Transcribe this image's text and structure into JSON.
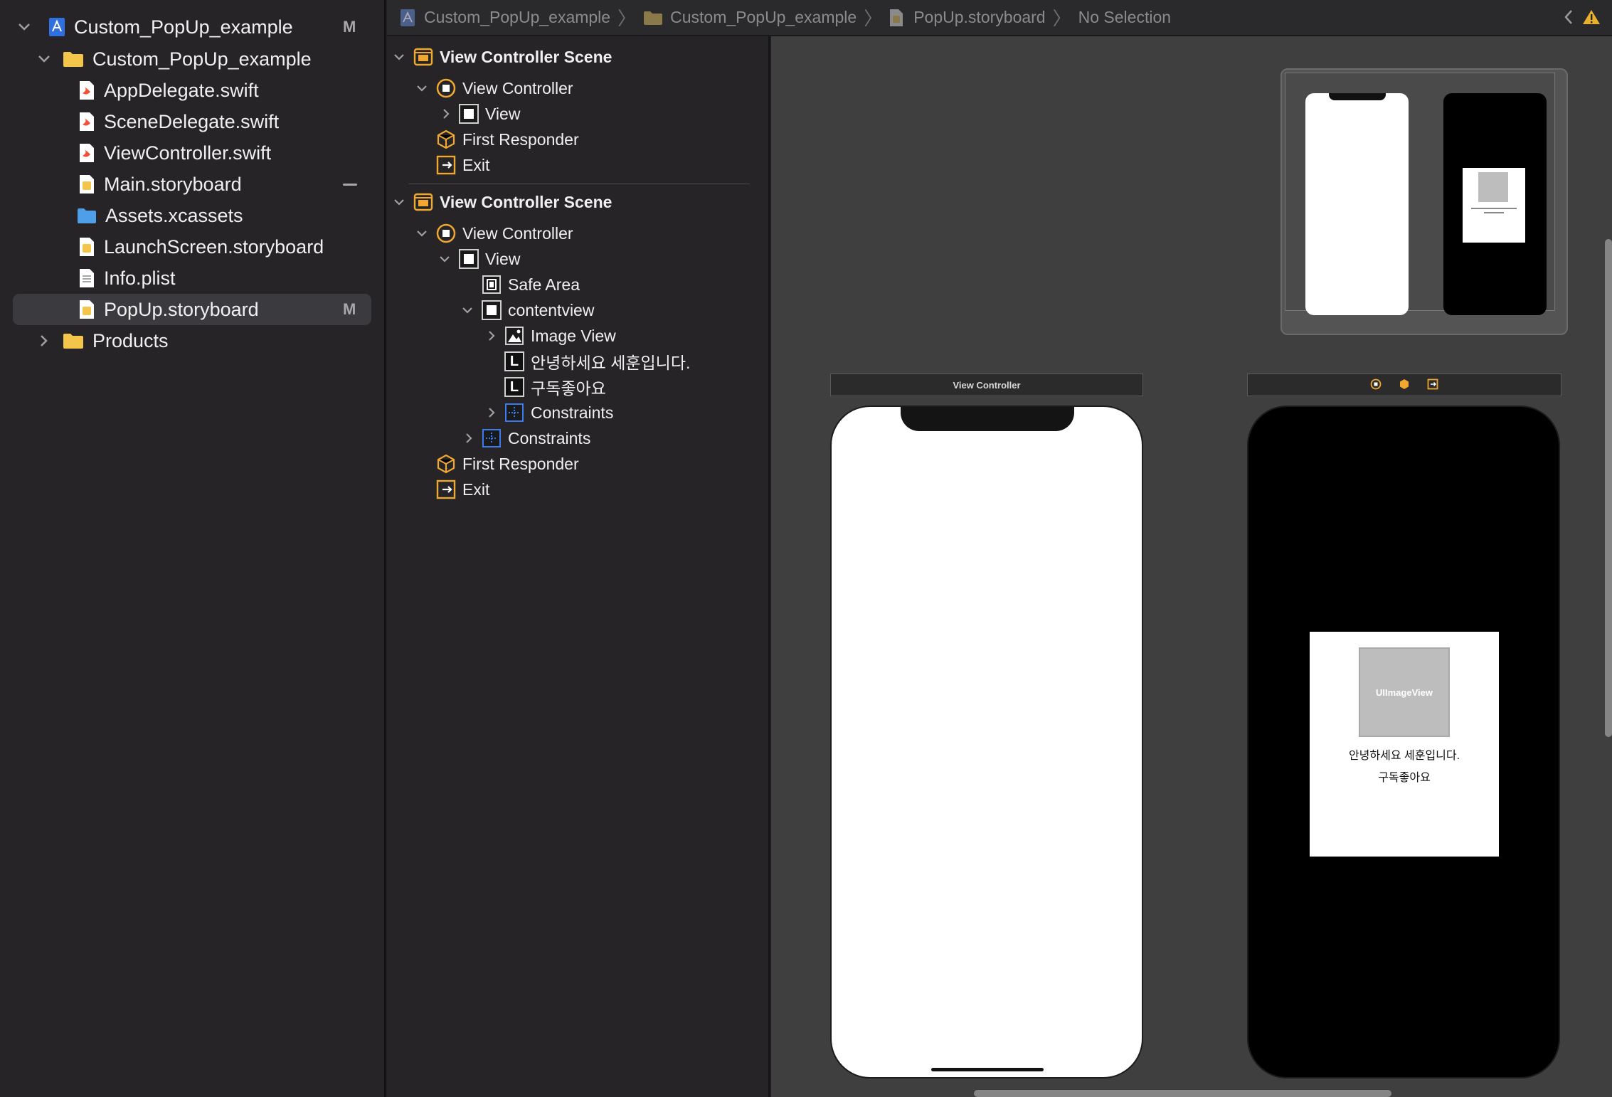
{
  "navigator": {
    "items": [
      {
        "label": "Custom_PopUp_example",
        "badge": "M",
        "icon": "project-icon"
      },
      {
        "label": "Custom_PopUp_example",
        "icon": "folder-icon"
      },
      {
        "label": "AppDelegate.swift",
        "icon": "swift-file-icon"
      },
      {
        "label": "SceneDelegate.swift",
        "icon": "swift-file-icon"
      },
      {
        "label": "ViewController.swift",
        "icon": "swift-file-icon"
      },
      {
        "label": "Main.storyboard",
        "icon": "storyboard-file-icon"
      },
      {
        "label": "Assets.xcassets",
        "icon": "asset-catalog-icon"
      },
      {
        "label": "LaunchScreen.storyboard",
        "icon": "storyboard-file-icon"
      },
      {
        "label": "Info.plist",
        "icon": "plist-file-icon"
      },
      {
        "label": "PopUp.storyboard",
        "badge": "M",
        "icon": "storyboard-file-icon"
      },
      {
        "label": "Products",
        "icon": "folder-icon"
      }
    ]
  },
  "breadcrumb": {
    "project": "Custom_PopUp_example",
    "group": "Custom_PopUp_example",
    "file": "PopUp.storyboard",
    "selection": "No Selection"
  },
  "outline": {
    "scene1": {
      "title": "View Controller Scene",
      "view_controller": "View Controller",
      "view": "View",
      "first_responder": "First Responder",
      "exit": "Exit"
    },
    "scene2": {
      "title": "View Controller Scene",
      "view_controller": "View Controller",
      "view": "View",
      "safe_area": "Safe Area",
      "contentview": "contentview",
      "image_view": "Image View",
      "label1": "안녕하세요 세훈입니다.",
      "label2": "구독좋아요",
      "constraints_inner": "Constraints",
      "constraints_outer": "Constraints",
      "first_responder": "First Responder",
      "exit": "Exit"
    },
    "label_icon_letter": "L"
  },
  "canvas": {
    "scene1_bar_title": "View Controller",
    "uiimageview_placeholder": "UIImageView",
    "popup_line1": "안녕하세요 세훈입니다.",
    "popup_line2": "구독좋아요"
  },
  "colors": {
    "accent_orange": "#f0a830",
    "swift_red": "#f05138",
    "folder_yellow": "#f3c54a",
    "constraint_blue": "#3b7bf0"
  }
}
